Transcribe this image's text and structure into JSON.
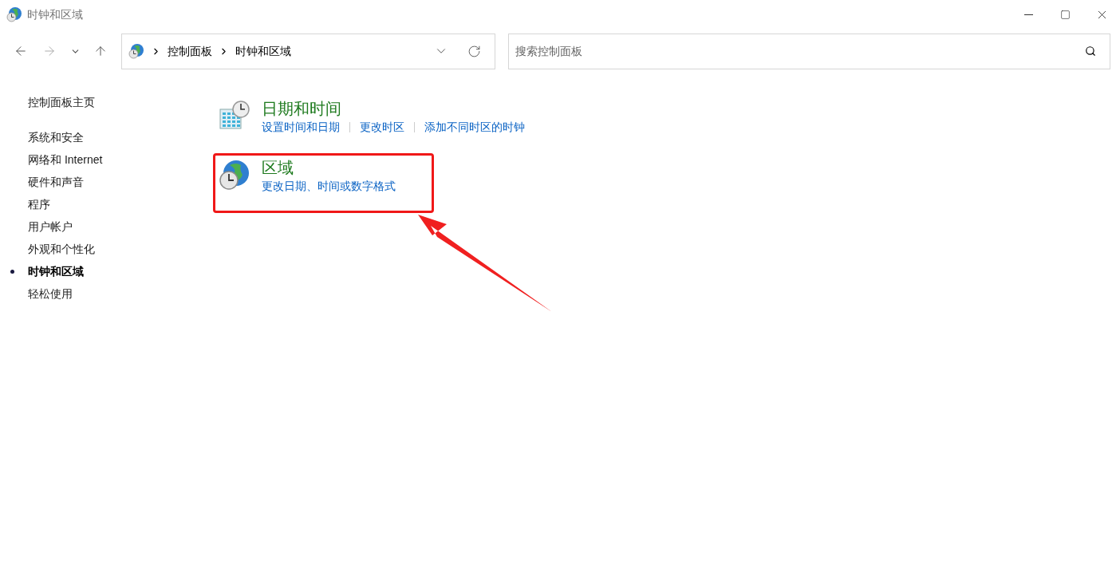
{
  "window": {
    "title": "时钟和区域"
  },
  "address_bar": {
    "breadcrumbs": [
      "控制面板",
      "时钟和区域"
    ]
  },
  "search": {
    "placeholder": "搜索控制面板"
  },
  "sidebar": {
    "home": "控制面板主页",
    "items": [
      {
        "label": "系统和安全",
        "selected": false
      },
      {
        "label": "网络和 Internet",
        "selected": false
      },
      {
        "label": "硬件和声音",
        "selected": false
      },
      {
        "label": "程序",
        "selected": false
      },
      {
        "label": "用户帐户",
        "selected": false
      },
      {
        "label": "外观和个性化",
        "selected": false
      },
      {
        "label": "时钟和区域",
        "selected": true
      },
      {
        "label": "轻松使用",
        "selected": false
      }
    ]
  },
  "sections": [
    {
      "kind": "datetime",
      "title": "日期和时间",
      "links": [
        "设置时间和日期",
        "更改时区",
        "添加不同时区的时钟"
      ],
      "highlighted": false
    },
    {
      "kind": "region",
      "title": "区域",
      "links": [
        "更改日期、时间或数字格式"
      ],
      "highlighted": true
    }
  ]
}
